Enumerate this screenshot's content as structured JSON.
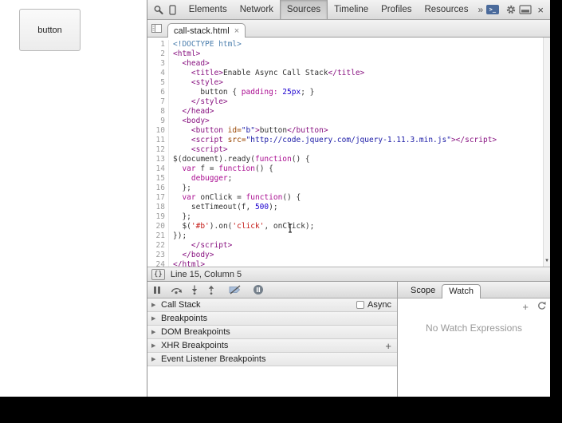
{
  "page": {
    "button_label": "button"
  },
  "devtools": {
    "toolbar": {
      "tabs": [
        "Elements",
        "Network",
        "Sources",
        "Timeline",
        "Profiles",
        "Resources"
      ],
      "active_tab": "Sources",
      "overflow_chevron": "»",
      "console_glyph": ">_",
      "close_glyph": "×"
    },
    "tabbar": {
      "file_name": "call-stack.html",
      "close_glyph": "×"
    },
    "editor": {
      "lines": [
        {
          "n": 1,
          "s": [
            [
              "<!DOCTYPE html>",
              "m"
            ]
          ]
        },
        {
          "n": 2,
          "s": [
            [
              "<html>",
              "t"
            ]
          ]
        },
        {
          "n": 3,
          "s": [
            [
              "  ",
              ""
            ],
            [
              "<head>",
              "t"
            ]
          ]
        },
        {
          "n": 4,
          "s": [
            [
              "    ",
              ""
            ],
            [
              "<title>",
              "t"
            ],
            [
              "Enable Async Call Stack",
              ""
            ],
            [
              "</title>",
              "t"
            ]
          ]
        },
        {
          "n": 5,
          "s": [
            [
              "    ",
              ""
            ],
            [
              "<style>",
              "t"
            ]
          ]
        },
        {
          "n": 6,
          "s": [
            [
              "      button { ",
              ""
            ],
            [
              "padding:",
              "k"
            ],
            [
              " ",
              ""
            ],
            [
              "25px",
              "n"
            ],
            [
              "; }",
              ""
            ]
          ]
        },
        {
          "n": 7,
          "s": [
            [
              "    ",
              ""
            ],
            [
              "</style>",
              "t"
            ]
          ]
        },
        {
          "n": 8,
          "s": [
            [
              "  ",
              ""
            ],
            [
              "</head>",
              "t"
            ]
          ]
        },
        {
          "n": 9,
          "s": [
            [
              "  ",
              ""
            ],
            [
              "<body>",
              "t"
            ]
          ]
        },
        {
          "n": 10,
          "s": [
            [
              "    ",
              ""
            ],
            [
              "<button ",
              "t"
            ],
            [
              "id=",
              "a"
            ],
            [
              "\"b\"",
              "v"
            ],
            [
              ">",
              "t"
            ],
            [
              "button",
              ""
            ],
            [
              "</button>",
              "t"
            ]
          ]
        },
        {
          "n": 11,
          "s": [
            [
              "    ",
              ""
            ],
            [
              "<script ",
              "t"
            ],
            [
              "src=",
              "a"
            ],
            [
              "\"http://code.jquery.com/jquery-1.11.3.min.js\"",
              "v"
            ],
            [
              "></script>",
              "t"
            ]
          ]
        },
        {
          "n": 12,
          "s": [
            [
              "    ",
              ""
            ],
            [
              "<script>",
              "t"
            ]
          ]
        },
        {
          "n": 13,
          "s": [
            [
              "$(document).ready(",
              ""
            ],
            [
              "function",
              "k"
            ],
            [
              "() {",
              ""
            ]
          ]
        },
        {
          "n": 14,
          "s": [
            [
              "  ",
              ""
            ],
            [
              "var",
              "k"
            ],
            [
              " f = ",
              ""
            ],
            [
              "function",
              "k"
            ],
            [
              "() {",
              ""
            ]
          ]
        },
        {
          "n": 15,
          "s": [
            [
              "    ",
              ""
            ],
            [
              "debugger",
              "k"
            ],
            [
              ";",
              ""
            ]
          ]
        },
        {
          "n": 16,
          "s": [
            [
              "  };",
              ""
            ]
          ]
        },
        {
          "n": 17,
          "s": [
            [
              "  ",
              ""
            ],
            [
              "var",
              "k"
            ],
            [
              " onClick = ",
              ""
            ],
            [
              "function",
              "k"
            ],
            [
              "() {",
              ""
            ]
          ]
        },
        {
          "n": 18,
          "s": [
            [
              "    setTimeout(f, ",
              ""
            ],
            [
              "500",
              "n"
            ],
            [
              ");",
              ""
            ]
          ]
        },
        {
          "n": 19,
          "s": [
            [
              "  };",
              ""
            ]
          ]
        },
        {
          "n": 20,
          "s": [
            [
              "  $(",
              ""
            ],
            [
              "'#b'",
              "s"
            ],
            [
              ").on(",
              ""
            ],
            [
              "'click'",
              "s"
            ],
            [
              ", onClick);",
              ""
            ]
          ]
        },
        {
          "n": 21,
          "s": [
            [
              "});",
              ""
            ]
          ]
        },
        {
          "n": 22,
          "s": [
            [
              "    ",
              ""
            ],
            [
              "</script>",
              "t"
            ]
          ]
        },
        {
          "n": 23,
          "s": [
            [
              "  ",
              ""
            ],
            [
              "</body>",
              "t"
            ]
          ]
        },
        {
          "n": 24,
          "s": [
            [
              "</html>",
              "t"
            ]
          ]
        }
      ]
    },
    "statusbar": {
      "pretty_print_glyph": "{}",
      "position_text": "Line 15, Column 5"
    },
    "debugger": {
      "sections": [
        {
          "label": "Call Stack",
          "right": "async"
        },
        {
          "label": "Breakpoints",
          "right": ""
        },
        {
          "label": "DOM Breakpoints",
          "right": ""
        },
        {
          "label": "XHR Breakpoints",
          "right": "plus"
        },
        {
          "label": "Event Listener Breakpoints",
          "right": ""
        }
      ],
      "async_label": "Async",
      "plus_glyph": "+",
      "disclosure_glyph": "▶"
    },
    "sidebar": {
      "tabs": [
        "Scope",
        "Watch"
      ],
      "active_tab": "Watch",
      "empty_text": "No Watch Expressions",
      "add_glyph": "+"
    },
    "scrollbar": {
      "down_glyph": "▼"
    }
  },
  "colors": {
    "tag": "#881280",
    "attribute": "#994500",
    "attr_value": "#1a1aa6",
    "keyword": "#aa0d91",
    "number": "#1c00cf",
    "string": "#c41a16",
    "doctype": "#4c7fae",
    "toolbar_top": "#f3f3f3",
    "toolbar_bottom": "#dadada"
  }
}
